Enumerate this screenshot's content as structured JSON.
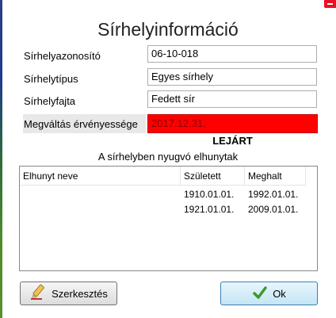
{
  "window": {
    "title": "Sírhelyinformáció"
  },
  "fields": [
    {
      "label": "Sírhelyazonosító",
      "value": "06-10-018"
    },
    {
      "label": "Sírhelytípus",
      "value": "Egyes sírhely"
    },
    {
      "label": "Sírhelyfajta",
      "value": "Fedett sír"
    }
  ],
  "expiry": {
    "label": "Megváltás érvényessége",
    "value": "2017.12.31.",
    "status": "LEJÁRT",
    "status_color": "#ff0000"
  },
  "deceased": {
    "section_title": "A sírhelyben nyugvó elhunytak",
    "columns": [
      "Elhunyt neve",
      "Született",
      "Meghalt"
    ],
    "rows": [
      {
        "name": "",
        "born": "1910.01.01.",
        "died": "1992.01.01."
      },
      {
        "name": "",
        "born": "1921.01.01.",
        "died": "2009.01.01."
      }
    ]
  },
  "buttons": {
    "edit_label": "Szerkesztés",
    "edit_icon": "pencil-icon",
    "ok_label": "Ok",
    "ok_icon": "checkmark-icon"
  }
}
